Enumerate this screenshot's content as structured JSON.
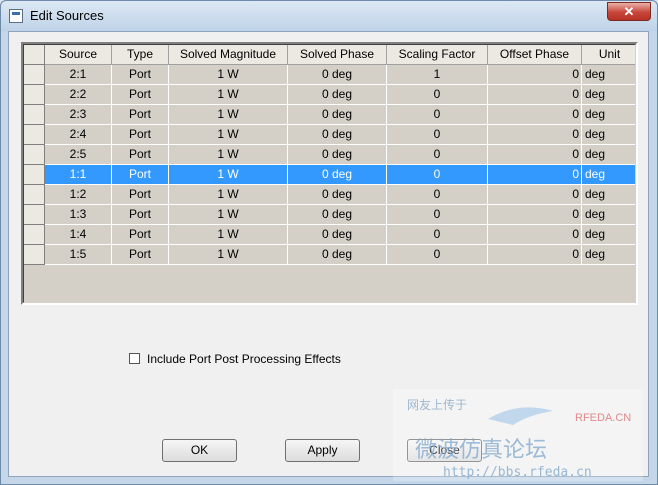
{
  "window": {
    "title": "Edit Sources",
    "close_glyph": "✕"
  },
  "grid": {
    "columns": [
      "Source",
      "Type",
      "Solved Magnitude",
      "Solved Phase",
      "Scaling Factor",
      "Offset Phase",
      "Unit"
    ],
    "selected_index": 5,
    "rows": [
      {
        "source": "2:1",
        "type": "Port",
        "magnitude": "1 W",
        "phase": "0 deg",
        "scaling": "1",
        "offset": "0",
        "unit": "deg"
      },
      {
        "source": "2:2",
        "type": "Port",
        "magnitude": "1 W",
        "phase": "0 deg",
        "scaling": "0",
        "offset": "0",
        "unit": "deg"
      },
      {
        "source": "2:3",
        "type": "Port",
        "magnitude": "1 W",
        "phase": "0 deg",
        "scaling": "0",
        "offset": "0",
        "unit": "deg"
      },
      {
        "source": "2:4",
        "type": "Port",
        "magnitude": "1 W",
        "phase": "0 deg",
        "scaling": "0",
        "offset": "0",
        "unit": "deg"
      },
      {
        "source": "2:5",
        "type": "Port",
        "magnitude": "1 W",
        "phase": "0 deg",
        "scaling": "0",
        "offset": "0",
        "unit": "deg"
      },
      {
        "source": "1:1",
        "type": "Port",
        "magnitude": "1 W",
        "phase": "0 deg",
        "scaling": "0",
        "offset": "0",
        "unit": "deg"
      },
      {
        "source": "1:2",
        "type": "Port",
        "magnitude": "1 W",
        "phase": "0 deg",
        "scaling": "0",
        "offset": "0",
        "unit": "deg"
      },
      {
        "source": "1:3",
        "type": "Port",
        "magnitude": "1 W",
        "phase": "0 deg",
        "scaling": "0",
        "offset": "0",
        "unit": "deg"
      },
      {
        "source": "1:4",
        "type": "Port",
        "magnitude": "1 W",
        "phase": "0 deg",
        "scaling": "0",
        "offset": "0",
        "unit": "deg"
      },
      {
        "source": "1:5",
        "type": "Port",
        "magnitude": "1 W",
        "phase": "0 deg",
        "scaling": "0",
        "offset": "0",
        "unit": "deg"
      }
    ]
  },
  "options": {
    "include_post_processing_label": "Include Port Post Processing Effects",
    "include_post_processing_checked": false
  },
  "buttons": {
    "ok": "OK",
    "apply": "Apply",
    "close": "Close"
  },
  "watermark": {
    "line1": "网友上传于",
    "brand": "RFEDA.CN",
    "chinese": "微波仿真论坛",
    "url": "http://bbs.rfeda.cn"
  }
}
